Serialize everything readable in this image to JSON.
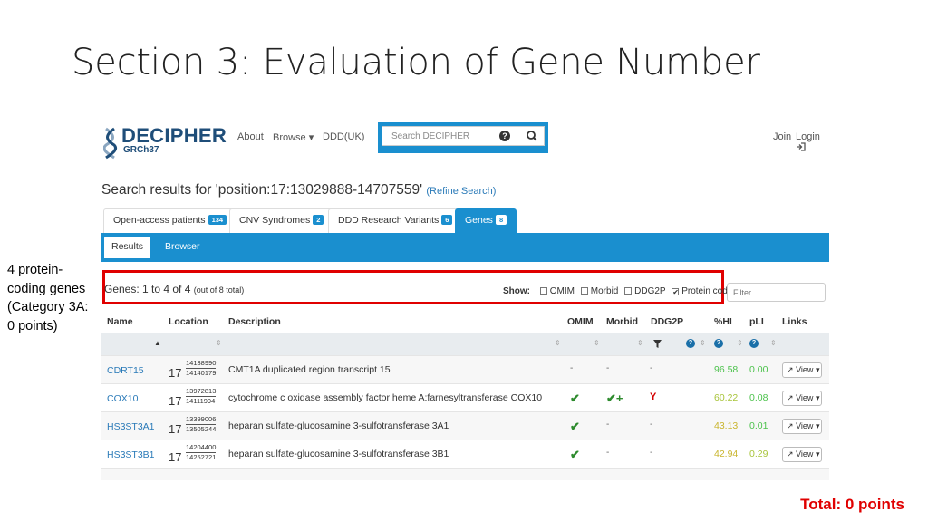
{
  "slide": {
    "title": "Section 3: Evaluation of Gene Number",
    "side_note": [
      "4 protein-",
      "coding genes",
      "(Category 3A:",
      "0 points)"
    ],
    "total": "Total: 0 points"
  },
  "navbar": {
    "logo": "DECIPHER",
    "logo_sub": "GRCh37",
    "links": [
      "About",
      "Browse ▾",
      "DDD(UK)"
    ],
    "search_placeholder": "Search DECIPHER",
    "help_icon": "question-circle-icon",
    "search_icon": "search-icon",
    "join": "Join",
    "login": "Login"
  },
  "results": {
    "title": "Search results for 'position:17:13029888-14707559'",
    "refine": "(Refine Search)"
  },
  "tabs": [
    {
      "label": "Open-access patients",
      "count": "134"
    },
    {
      "label": "CNV Syndromes",
      "count": "2"
    },
    {
      "label": "DDD Research Variants",
      "count": "6"
    },
    {
      "label": "Genes",
      "count": "8"
    }
  ],
  "subtabs": [
    "Results",
    "Browser"
  ],
  "genes_summary": {
    "main": "Genes: 1 to 4 of 4",
    "sub": "(out of 8 total)"
  },
  "show": {
    "label": "Show:",
    "options": [
      {
        "label": "OMIM",
        "checked": false
      },
      {
        "label": "Morbid",
        "checked": false
      },
      {
        "label": "DDG2P",
        "checked": false
      },
      {
        "label": "Protein coding",
        "checked": true
      }
    ],
    "filter_placeholder": "Filter..."
  },
  "table": {
    "headers": [
      "Name",
      "Location",
      "Description",
      "OMIM",
      "Morbid",
      "DDG2P",
      "%HI",
      "pLI",
      "Links"
    ],
    "rows": [
      {
        "name": "CDRT15",
        "chr": "17",
        "start": "14138990",
        "end": "14140179",
        "desc": "CMT1A duplicated region transcript 15",
        "omim": "-",
        "morbid": "-",
        "ddg2p": "-",
        "hi": "96.58",
        "pli": "0.00",
        "view": "View"
      },
      {
        "name": "COX10",
        "chr": "17",
        "start": "13972813",
        "end": "14111994",
        "desc": "cytochrome c oxidase assembly factor heme A:farnesyltransferase COX10",
        "omim": "✔",
        "morbid": "✔+",
        "ddg2p": "Y",
        "hi": "60.22",
        "pli": "0.08",
        "view": "View"
      },
      {
        "name": "HS3ST3A1",
        "chr": "17",
        "start": "13399006",
        "end": "13505244",
        "desc": "heparan sulfate-glucosamine 3-sulfotransferase 3A1",
        "omim": "✔",
        "morbid": "-",
        "ddg2p": "-",
        "hi": "43.13",
        "pli": "0.01",
        "view": "View"
      },
      {
        "name": "HS3ST3B1",
        "chr": "17",
        "start": "14204400",
        "end": "14252721",
        "desc": "heparan sulfate-glucosamine 3-sulfotransferase 3B1",
        "omim": "✔",
        "morbid": "-",
        "ddg2p": "-",
        "hi": "42.94",
        "pli": "0.29",
        "view": "View"
      }
    ],
    "hi_colors": [
      "#4cc24c",
      "#a8c43a",
      "#c9b52e",
      "#c9b52e"
    ],
    "pli_colors": [
      "#4cc24c",
      "#4cc24c",
      "#4cc24c",
      "#a8c43a"
    ]
  }
}
